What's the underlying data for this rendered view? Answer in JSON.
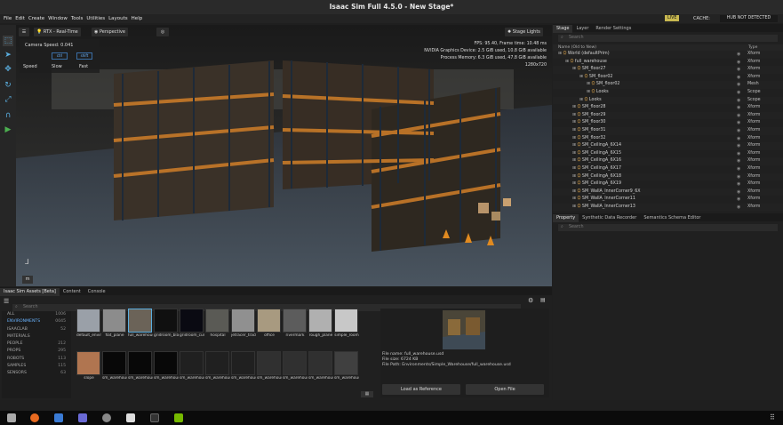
{
  "window": {
    "title": "Isaac Sim Full 4.5.0 - New Stage*"
  },
  "menu": [
    "File",
    "Edit",
    "Create",
    "Window",
    "Tools",
    "Utilities",
    "Layouts",
    "Help"
  ],
  "status": {
    "live": "LIVE",
    "cache_label": "CACHE:",
    "hub": "HUB NOT DETECTED"
  },
  "viewport": {
    "renderer": "RTX - Real-Time",
    "camera": "Perspective",
    "stage_lights": "Stage Lights",
    "camera_speed": "Camera Speed: 0.041",
    "speed_label": "Speed",
    "slow_label": "Slow",
    "fast_label": "Fast",
    "slow_key": "ctrl",
    "fast_key": "shift",
    "fps": "FPS: 95.40, Frame time: 10.48 ms",
    "gpu": "NVIDIA Graphics Device: 2.5 GiB used, 10.8 GiB available",
    "memory": "Process Memory: 6.3 GiB used, 47.8 GiB available",
    "resolution": "1280x720",
    "axis_label": "m"
  },
  "stage": {
    "tabs": [
      "Stage",
      "Layer",
      "Render Settings"
    ],
    "search_placeholder": "Search",
    "col_name": "Name (Old to New)",
    "col_type": "Type",
    "rows": [
      {
        "name": "World (defaultPrim)",
        "type": "Xform",
        "indent": 0
      },
      {
        "name": "full_warehouse",
        "type": "Xform",
        "indent": 1
      },
      {
        "name": "SM_floor27",
        "type": "Xform",
        "indent": 2
      },
      {
        "name": "SM_floor02",
        "type": "Xform",
        "indent": 3
      },
      {
        "name": "SM_floor02",
        "type": "Mesh",
        "indent": 4
      },
      {
        "name": "Looks",
        "type": "Scope",
        "indent": 4
      },
      {
        "name": "Looks",
        "type": "Scope",
        "indent": 3
      },
      {
        "name": "SM_floor28",
        "type": "Xform",
        "indent": 2
      },
      {
        "name": "SM_floor29",
        "type": "Xform",
        "indent": 2
      },
      {
        "name": "SM_floor30",
        "type": "Xform",
        "indent": 2
      },
      {
        "name": "SM_floor31",
        "type": "Xform",
        "indent": 2
      },
      {
        "name": "SM_floor32",
        "type": "Xform",
        "indent": 2
      },
      {
        "name": "SM_CeilingA_6X14",
        "type": "Xform",
        "indent": 2
      },
      {
        "name": "SM_CeilingA_6X15",
        "type": "Xform",
        "indent": 2
      },
      {
        "name": "SM_CeilingA_6X16",
        "type": "Xform",
        "indent": 2
      },
      {
        "name": "SM_CeilingA_6X17",
        "type": "Xform",
        "indent": 2
      },
      {
        "name": "SM_CeilingA_6X18",
        "type": "Xform",
        "indent": 2
      },
      {
        "name": "SM_CeilingA_6X19",
        "type": "Xform",
        "indent": 2
      },
      {
        "name": "SM_WallA_InnerCorner9_6X",
        "type": "Xform",
        "indent": 2
      },
      {
        "name": "SM_WallA_InnerCorner11",
        "type": "Xform",
        "indent": 2
      },
      {
        "name": "SM_WallA_InnerCorner13",
        "type": "Xform",
        "indent": 2
      }
    ]
  },
  "property": {
    "tabs": [
      "Property",
      "Synthetic Data Recorder",
      "Semantics Schema Editor"
    ],
    "search_placeholder": "Search"
  },
  "assets": {
    "tabs": [
      "Isaac Sim Assets [Beta]",
      "Content",
      "Console"
    ],
    "search_placeholder": "Search",
    "categories": [
      {
        "label": "ALL",
        "count": "1006",
        "active": false
      },
      {
        "label": "ENVIRONMENTS",
        "count": "0045",
        "active": true
      },
      {
        "label": "ISAACLAB",
        "count": "52",
        "active": false
      },
      {
        "label": "MATERIALS",
        "count": "",
        "active": false
      },
      {
        "label": "PEOPLE",
        "count": "212",
        "active": false
      },
      {
        "label": "PROPS",
        "count": "295",
        "active": false
      },
      {
        "label": "ROBOTS",
        "count": "113",
        "active": false
      },
      {
        "label": "SAMPLES",
        "count": "115",
        "active": false
      },
      {
        "label": "SENSORS",
        "count": "63",
        "active": false
      }
    ],
    "row1": [
      {
        "label": "default_environment",
        "color": "#9aa0a8"
      },
      {
        "label": "flat_plane",
        "color": "#8c8c8c"
      },
      {
        "label": "full_warehouse",
        "color": "#6b6358"
      },
      {
        "label": "gridroom_black",
        "color": "#101010"
      },
      {
        "label": "gridroom_curved",
        "color": "#0a0a12"
      },
      {
        "label": "hospital",
        "color": "#5a5a55"
      },
      {
        "label": "jetracer_track_solid",
        "color": "#909090"
      },
      {
        "label": "office",
        "color": "#a89a80"
      },
      {
        "label": "rivermark",
        "color": "#5c5c5c"
      },
      {
        "label": "rough_plane",
        "color": "#b0b0b0"
      },
      {
        "label": "simple_room",
        "color": "#c8c8c8"
      }
    ],
    "row2": [
      {
        "label": "slope",
        "color": "#b07550"
      },
      {
        "label": "sm_warehouse...1_01",
        "color": "#080808"
      },
      {
        "label": "sm_warehouse...2_01",
        "color": "#080808"
      },
      {
        "label": "sm_warehouse...3_01",
        "color": "#080808"
      },
      {
        "label": "sm_warehouse...r_01",
        "color": "#202020"
      },
      {
        "label": "sm_warehouse...r_01",
        "color": "#202020"
      },
      {
        "label": "sm_warehouse...4_01",
        "color": "#202020"
      },
      {
        "label": "sm_warehouse...r_01",
        "color": "#303030"
      },
      {
        "label": "sm_warehouse...r_01",
        "color": "#303030"
      },
      {
        "label": "sm_warehouse...r_01",
        "color": "#303030"
      },
      {
        "label": "sm_warehouse...0_01",
        "color": "#404040"
      }
    ],
    "detail": {
      "file_name": "File name: full_warehouse.usd",
      "file_size": "File size: 6724 KB",
      "file_path": "File Path: Environments/Simple_Warehouse/full_warehouse.usd",
      "load_ref": "Load as Reference",
      "open_file": "Open File"
    }
  },
  "colors": {
    "accent": "#5aaedf",
    "folder": "#d9a24a",
    "active_cat": "#6ab4ff"
  }
}
